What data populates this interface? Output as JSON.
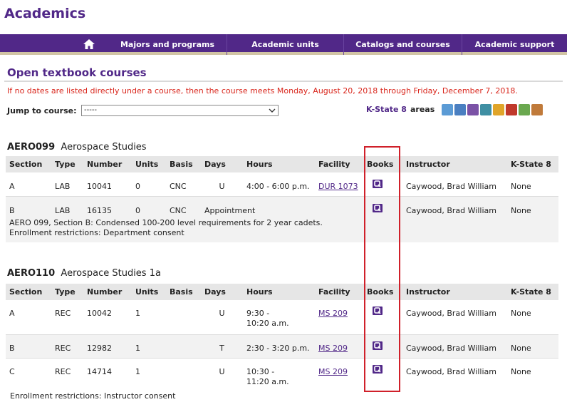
{
  "site": {
    "title": "Academics"
  },
  "nav": {
    "home_icon": "home-icon",
    "items": [
      "Majors and programs",
      "Academic units",
      "Catalogs and courses",
      "Academic support"
    ]
  },
  "page": {
    "title": "Open textbook courses",
    "notice": "If no dates are listed directly under a course, then the course meets Monday, August 20, 2018 through Friday, December 7, 2018."
  },
  "jump": {
    "label": "Jump to course:",
    "selected": "-----"
  },
  "ks8": {
    "link": "K-State 8",
    "rest": "areas",
    "colors": [
      "#5b9bd5",
      "#4a7fc1",
      "#7b52a6",
      "#3f8fa3",
      "#e0a52a",
      "#c0392b",
      "#6aa84f",
      "#c07a3a"
    ]
  },
  "columns": [
    "Section",
    "Type",
    "Number",
    "Units",
    "Basis",
    "Days",
    "Hours",
    "Facility",
    "Books",
    "Instructor",
    "K-State 8"
  ],
  "courses": [
    {
      "code": "AERO099",
      "name": "Aerospace Studies",
      "sections": [
        {
          "section": "A",
          "type": "LAB",
          "number": "10041",
          "units": "0",
          "basis": "CNC",
          "days": "U",
          "hours": "4:00 - 6:00 p.m.",
          "facility": "DUR 1073",
          "instructor": "Caywood, Brad William",
          "ks8": "None"
        },
        {
          "section": "B",
          "type": "LAB",
          "number": "16135",
          "units": "0",
          "basis": "CNC",
          "days": "Appointment",
          "hours": "",
          "facility": "",
          "instructor": "Caywood, Brad William",
          "ks8": "None"
        }
      ],
      "note1": "AERO 099, Section B: Condensed 100-200 level requirements for 2 year cadets.",
      "note2": "Enrollment restrictions: Department consent"
    },
    {
      "code": "AERO110",
      "name": "Aerospace Studies 1a",
      "sections": [
        {
          "section": "A",
          "type": "REC",
          "number": "10042",
          "units": "1",
          "basis": "",
          "days": "U",
          "hours1": "9:30 -",
          "hours2": "10:20 a.m.",
          "facility": "MS 209",
          "instructor": "Caywood, Brad William",
          "ks8": "None"
        },
        {
          "section": "B",
          "type": "REC",
          "number": "12982",
          "units": "1",
          "basis": "",
          "days": "T",
          "hours1": "2:30 - 3:20 p.m.",
          "hours2": "",
          "facility": "MS 209",
          "instructor": "Caywood, Brad William",
          "ks8": "None"
        },
        {
          "section": "C",
          "type": "REC",
          "number": "14714",
          "units": "1",
          "basis": "",
          "days": "U",
          "hours1": "10:30 -",
          "hours2": "11:20 a.m.",
          "facility": "MS 209",
          "instructor": "Caywood, Brad William",
          "ks8": "None"
        }
      ],
      "note": "Enrollment restrictions: Instructor consent"
    }
  ]
}
